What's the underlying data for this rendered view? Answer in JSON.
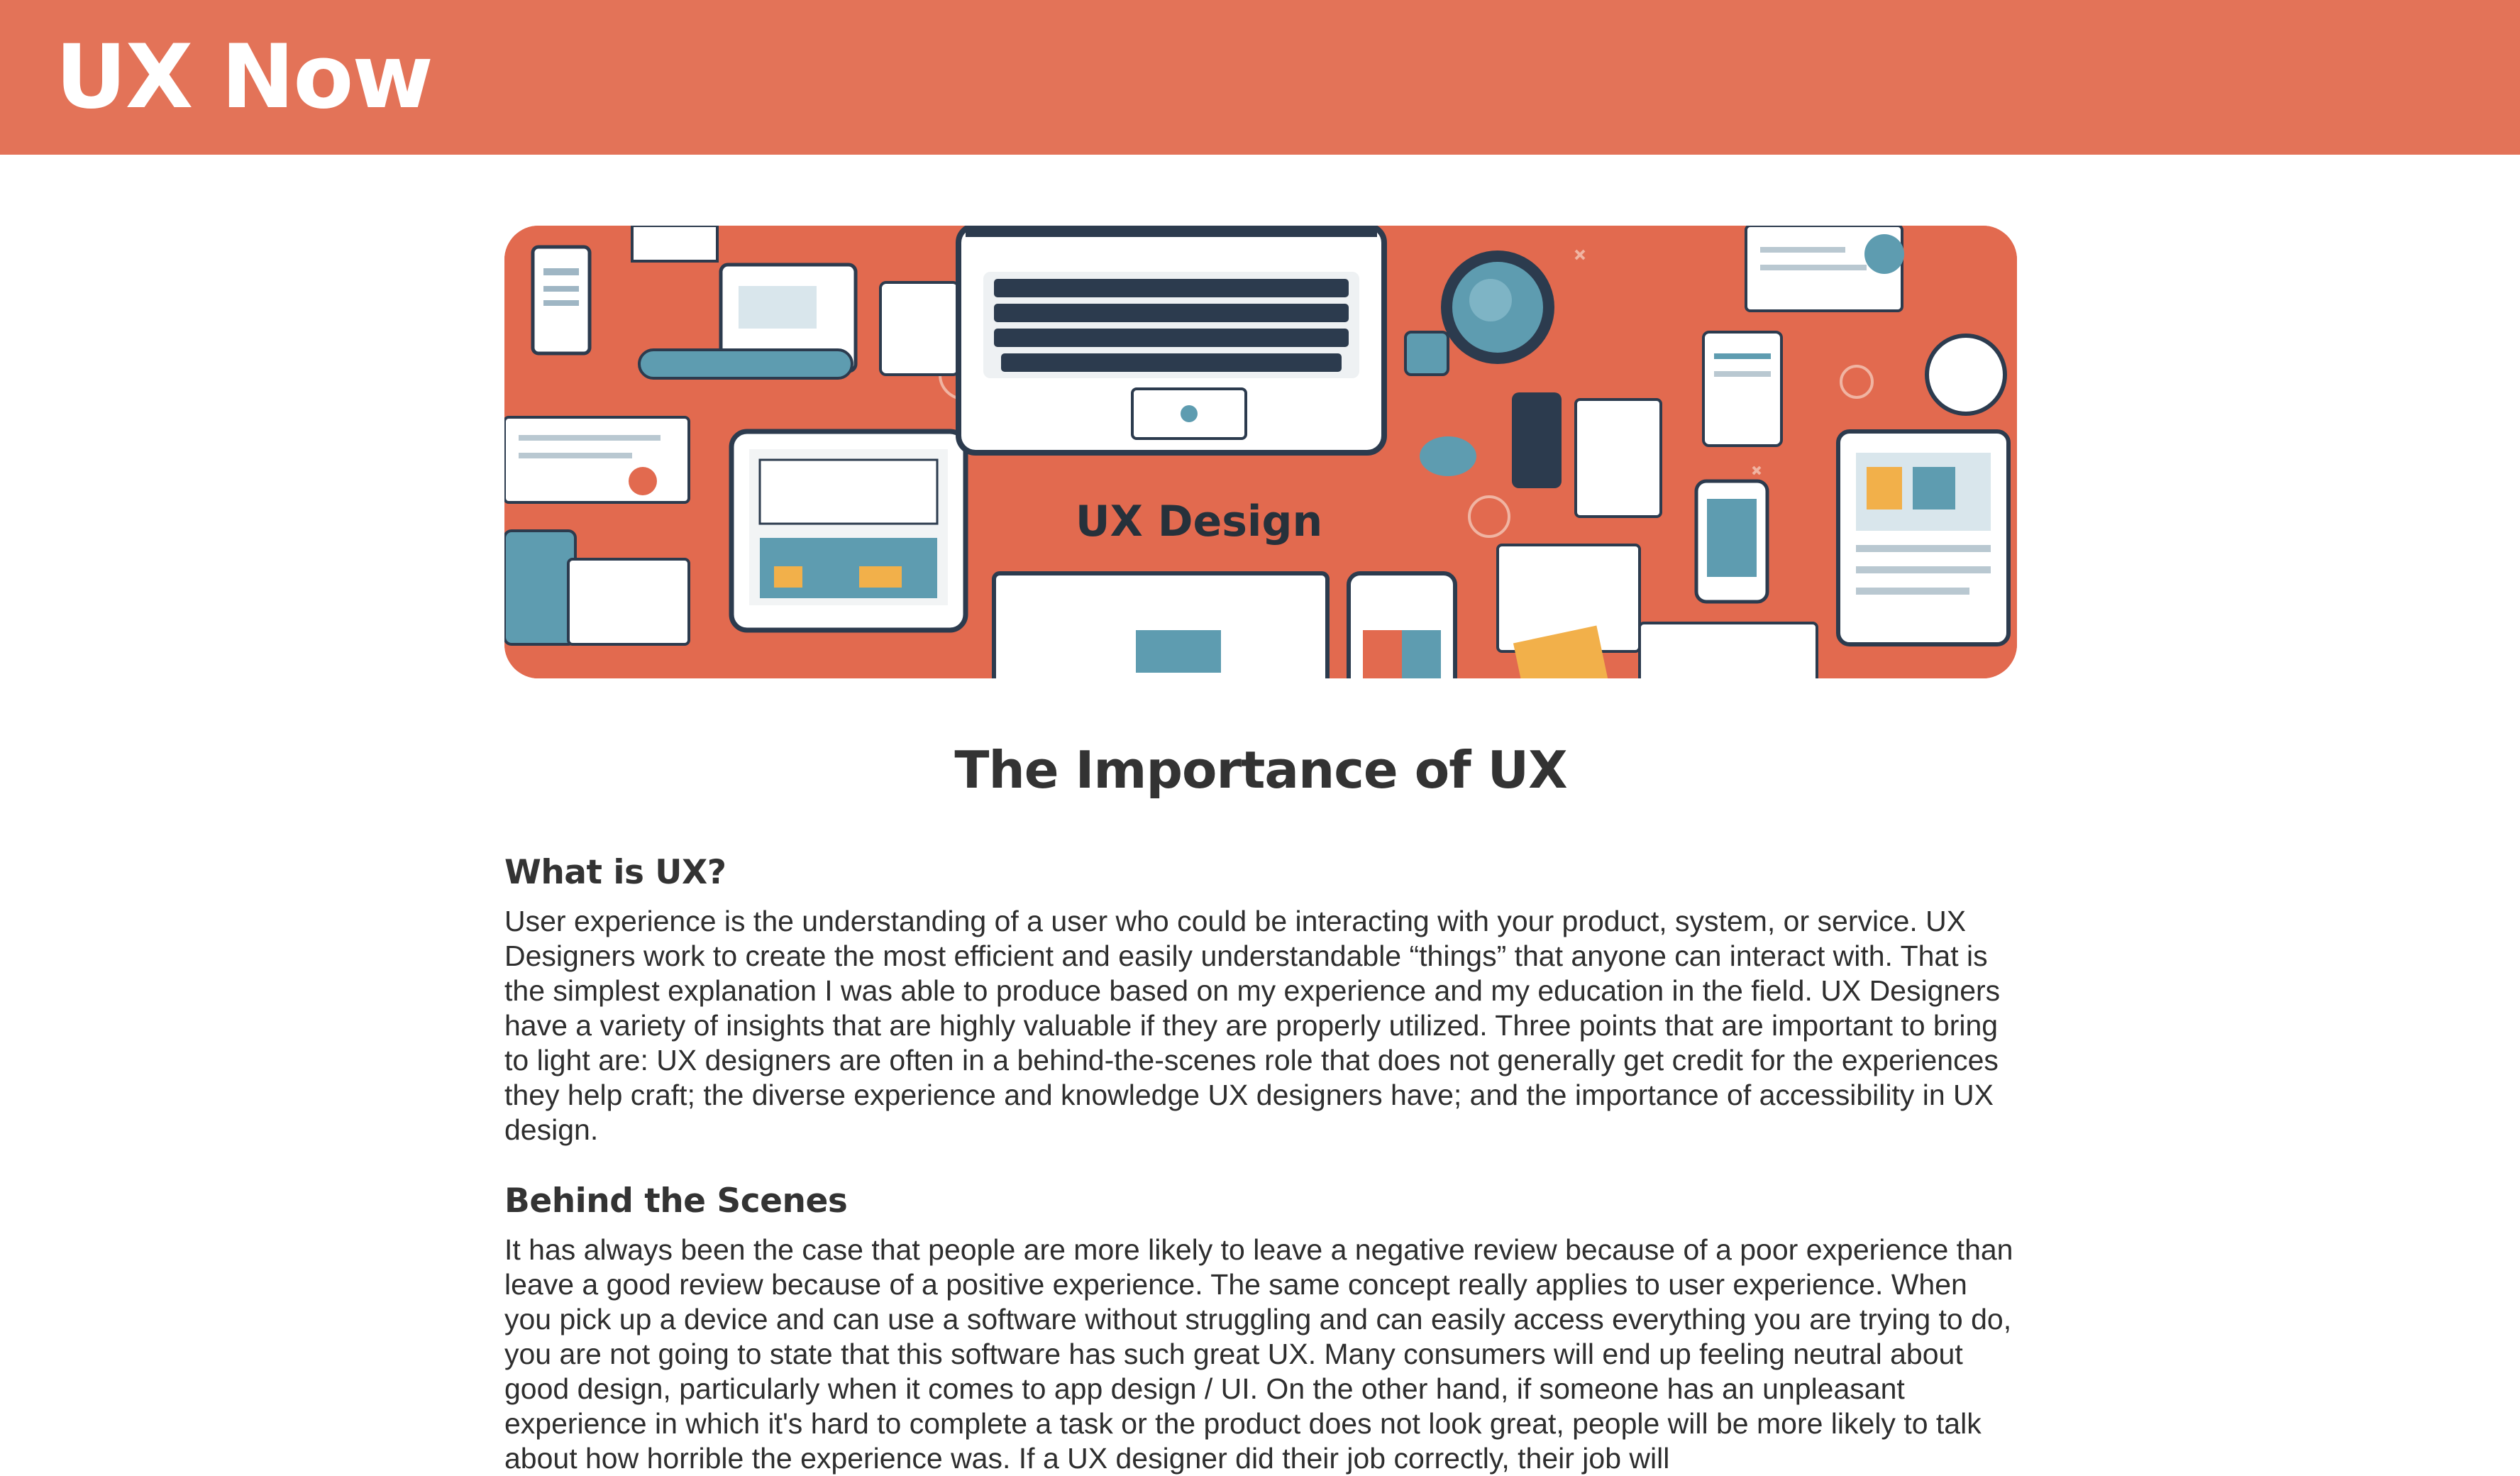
{
  "header": {
    "brand": "UX Now"
  },
  "hero": {
    "image_caption": "UX Design",
    "accent_color": "#e26a4f"
  },
  "article": {
    "title": "The Importance of UX",
    "sections": [
      {
        "heading": "What is UX?",
        "body": "User experience is the understanding of a user who could be interacting with your product, system, or service. UX Designers work to create the most efficient and easily understandable “things” that anyone can interact with. That is the simplest explanation I was able to produce based on my experience and my education in the field. UX Designers have a variety of insights that are highly valuable if they are properly utilized. Three points that are important to bring to light are: UX designers are often in a behind-the-scenes role that does not generally get credit for the experiences they help craft; the diverse experience and knowledge UX designers have; and the importance of accessibility in UX design."
      },
      {
        "heading": "Behind the Scenes",
        "body": "It has always been the case that people are more likely to leave a negative review because of a poor experience than leave a good review because of a positive experience. The same concept really applies to user experience. When you pick up a device and can use a software without struggling and can easily access everything you are trying to do, you are not going to state that this software has such great UX. Many consumers will end up feeling neutral about good design, particularly when it comes to app design / UI. On the other hand, if someone has an unpleasant experience in which it's hard to complete a task or the product does not look great, people will be more likely to talk about how horrible the experience was. If a UX designer did their job correctly, their job will"
      }
    ]
  },
  "colors": {
    "header_bg": "#e37358",
    "text": "#2e2e2e",
    "heading": "#333333"
  }
}
